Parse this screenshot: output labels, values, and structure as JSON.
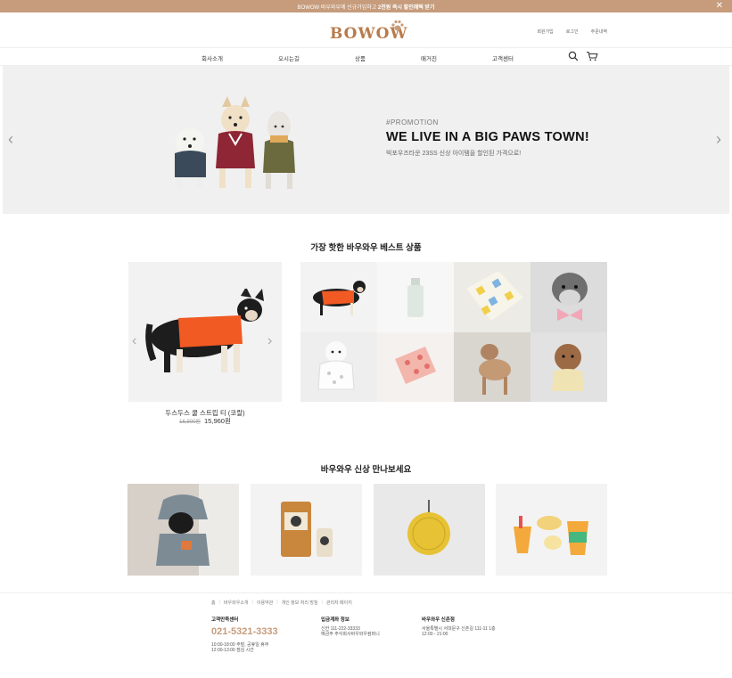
{
  "promo_bar": {
    "text_pre": "BOWOW 바우와우에 신규가입하고 ",
    "text_bold": "2천원 즉시 할인혜택 받기",
    "close": "✕"
  },
  "header": {
    "logo": "BOWOW",
    "util_links": [
      "회원가입",
      "로그인",
      "주문내역"
    ]
  },
  "nav": {
    "items": [
      "회사소개",
      "오시는길",
      "상품",
      "매거진",
      "고객센터"
    ]
  },
  "hero": {
    "tag": "#PROMOTION",
    "title": "WE LIVE IN A BIG PAWS TOWN!",
    "subtitle": "빅포우즈타운 23SS 신상 아이템을 할인된 가격으로!",
    "prev": "‹",
    "next": "›"
  },
  "best": {
    "title": "가장 핫한 바우와우 베스트 상품",
    "product_name": "두스두스 쿨 스트립 티 (코랄)",
    "original_price": "16,800원",
    "sale_price": "15,960원",
    "prev": "‹",
    "next": "›"
  },
  "new_items": {
    "title": "바우와우 신상 만나보세요"
  },
  "footer": {
    "links": [
      "홈",
      "바우와우소개",
      "이용약관",
      "개인 정보 처리 방침",
      "관리자 페이지"
    ],
    "cs": {
      "heading": "고객만족센터",
      "phone": "021-5321-3333",
      "hours1": "10:00-18:00 주말, 공휴일 휴무",
      "hours2": "12:00-13:00 점심 시간"
    },
    "bank": {
      "heading": "입금계좌 정보",
      "line1": "신한 111-222-33333",
      "line2": "예금주 주식회사바우와우컴퍼니"
    },
    "store": {
      "heading": "바우와우 신촌점",
      "line1": "서울특별시 서대문구 신촌길 111-11 1층",
      "line2": "12:00 - 21:00"
    }
  },
  "colors": {
    "brand": "#c69c7c",
    "logo": "#b87b4c"
  }
}
